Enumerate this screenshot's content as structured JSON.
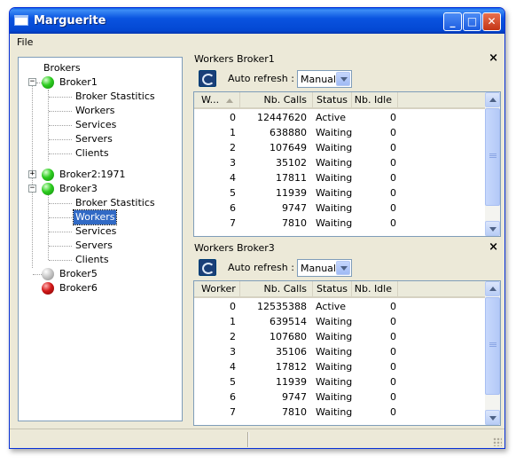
{
  "window": {
    "title": "Marguerite"
  },
  "menu": {
    "file": "File"
  },
  "tree": {
    "root": "Brokers",
    "broker1": {
      "label": "Broker1",
      "expander": "−",
      "children": [
        "Broker Stastitics",
        "Workers",
        "Services",
        "Servers",
        "Clients"
      ]
    },
    "broker2": {
      "label": "Broker2:1971",
      "expander": "+"
    },
    "broker3": {
      "label": "Broker3",
      "expander": "−",
      "children": [
        "Broker Stastitics",
        "Workers",
        "Services",
        "Servers",
        "Clients"
      ],
      "selected": "Workers"
    },
    "broker5": {
      "label": "Broker5"
    },
    "broker6": {
      "label": "Broker6"
    }
  },
  "panel1": {
    "title": "Workers Broker1",
    "close": "×",
    "refresh_label": "Auto refresh :",
    "refresh_value": "Manual",
    "columns": [
      "W...",
      "Nb. Calls",
      "Status",
      "Nb. Idle"
    ],
    "rows": [
      [
        "0",
        "12447620",
        "Active",
        "0"
      ],
      [
        "1",
        "638880",
        "Waiting",
        "0"
      ],
      [
        "2",
        "107649",
        "Waiting",
        "0"
      ],
      [
        "3",
        "35102",
        "Waiting",
        "0"
      ],
      [
        "4",
        "17811",
        "Waiting",
        "0"
      ],
      [
        "5",
        "11939",
        "Waiting",
        "0"
      ],
      [
        "6",
        "9747",
        "Waiting",
        "0"
      ],
      [
        "7",
        "7810",
        "Waiting",
        "0"
      ]
    ]
  },
  "panel2": {
    "title": "Workers Broker3",
    "close": "×",
    "refresh_label": "Auto refresh :",
    "refresh_value": "Manual",
    "columns": [
      "Worker",
      "Nb. Calls",
      "Status",
      "Nb. Idle"
    ],
    "rows": [
      [
        "0",
        "12535388",
        "Active",
        "0"
      ],
      [
        "1",
        "639514",
        "Waiting",
        "0"
      ],
      [
        "2",
        "107680",
        "Waiting",
        "0"
      ],
      [
        "3",
        "35106",
        "Waiting",
        "0"
      ],
      [
        "4",
        "17812",
        "Waiting",
        "0"
      ],
      [
        "5",
        "11939",
        "Waiting",
        "0"
      ],
      [
        "6",
        "9747",
        "Waiting",
        "0"
      ],
      [
        "7",
        "7810",
        "Waiting",
        "0"
      ]
    ]
  }
}
